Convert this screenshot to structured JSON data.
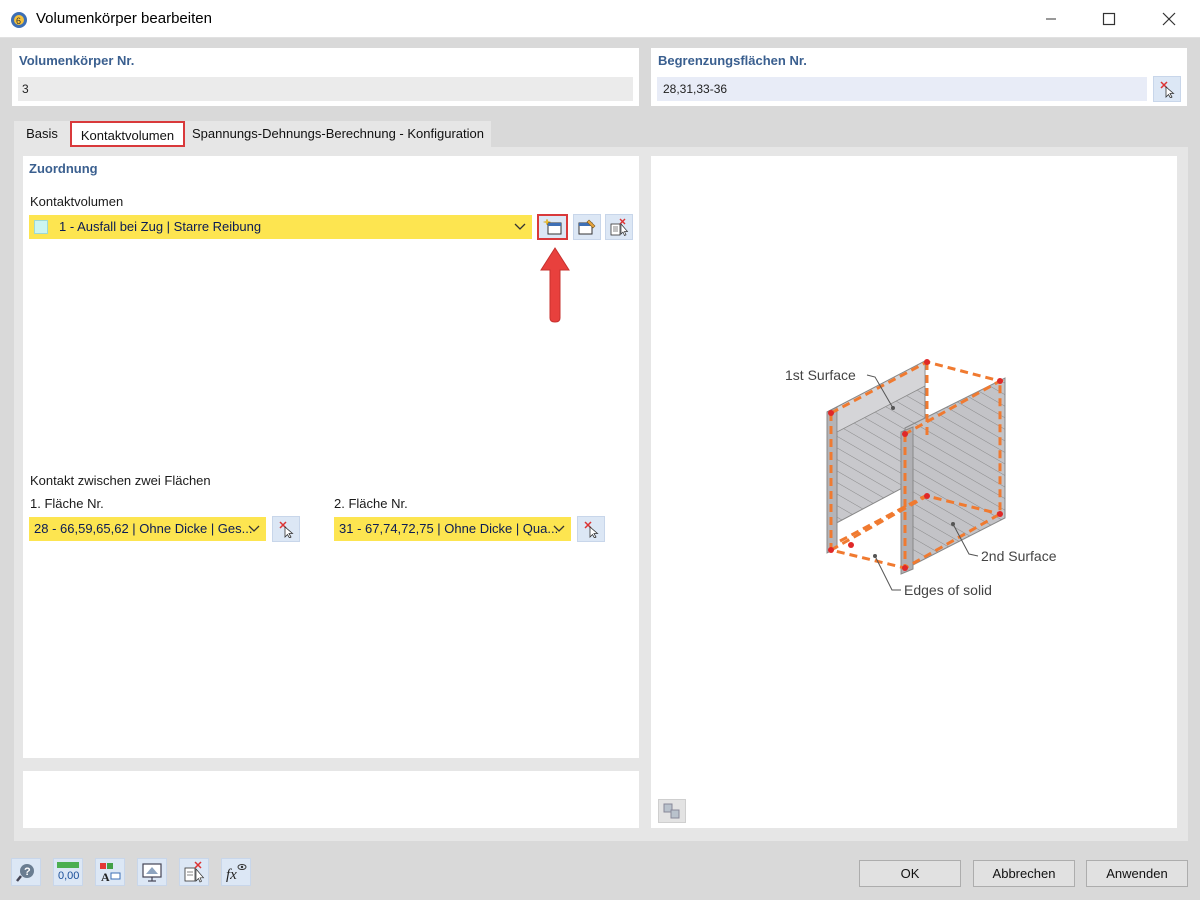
{
  "window": {
    "title": "Volumenkörper bearbeiten"
  },
  "header": {
    "solid_no_label": "Volumenkörper Nr.",
    "solid_no_value": "3",
    "boundary_label": "Begrenzungsflächen Nr.",
    "boundary_value": "28,31,33-36"
  },
  "tabs": [
    {
      "label": "Basis",
      "active": false
    },
    {
      "label": "Kontaktvolumen",
      "active": true
    },
    {
      "label": "Spannungs-Dehnungs-Berechnung - Konfiguration",
      "active": false
    }
  ],
  "assignment": {
    "group_title": "Zuordnung",
    "contact_volume_label": "Kontaktvolumen",
    "contact_volume_value": "1 - Ausfall bei Zug | Starre Reibung",
    "contact_between_label": "Kontakt zwischen zwei Flächen",
    "surface1_label": "1. Fläche Nr.",
    "surface1_value": "28 - 66,59,65,62 | Ohne Dicke | Ges...",
    "surface2_label": "2. Fläche Nr.",
    "surface2_value": "31 - 67,74,72,75 | Ohne Dicke | Qua..."
  },
  "diagram": {
    "label_first": "1st Surface",
    "label_second": "2nd Surface",
    "label_edges": "Edges of solid"
  },
  "buttons": {
    "ok": "OK",
    "cancel": "Abbrechen",
    "apply": "Anwenden"
  },
  "colors": {
    "highlight": "#d9393b",
    "combo_bg": "#fde550",
    "group_title": "#3a5f8f",
    "edge_dash": "#f07a30"
  }
}
